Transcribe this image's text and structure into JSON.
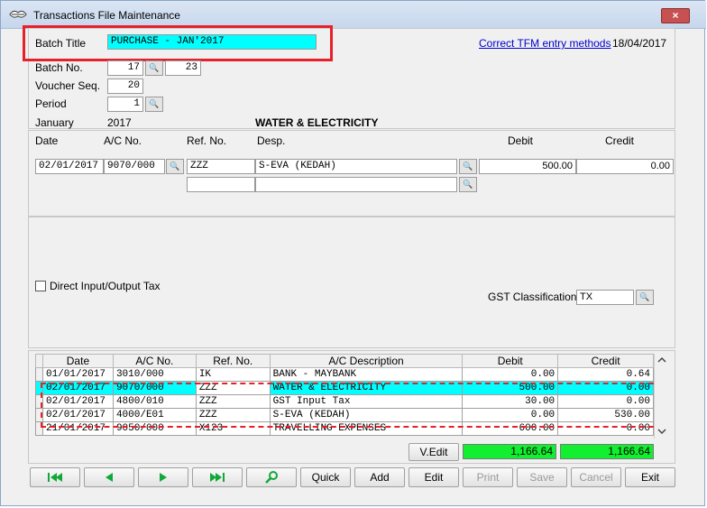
{
  "window": {
    "title": "Transactions File Maintenance",
    "close_glyph": "×"
  },
  "header": {
    "batch_title_label": "Batch Title",
    "batch_title_value": "PURCHASE - JAN'2017",
    "link_text": "Correct TFM entry methods",
    "date": "18/04/2017",
    "batch_no_label": "Batch No.",
    "batch_no_value": "17",
    "batch_no_extra": "23",
    "voucher_seq_label": "Voucher Seq.",
    "voucher_seq_value": "20",
    "period_label": "Period",
    "period_value": "1",
    "month": "January",
    "year": "2017",
    "account_name": "WATER & ELECTRICITY"
  },
  "entry": {
    "col_date": "Date",
    "col_ac": "A/C No.",
    "col_ref": "Ref. No.",
    "col_desp": "Desp.",
    "col_debit": "Debit",
    "col_credit": "Credit",
    "row_date": "02/01/2017",
    "row_ac": "9070/000",
    "row_ref": "ZZZ",
    "row_desp": "S-EVA (KEDAH)",
    "row_debit": "500.00",
    "row_credit": "0.00",
    "direct_tax_label": "Direct Input/Output Tax",
    "gst_label": "GST Classification",
    "gst_value": "TX"
  },
  "grid": {
    "headers": [
      "Date",
      "A/C No.",
      "Ref. No.",
      "A/C Description",
      "Debit",
      "Credit"
    ],
    "rows": [
      {
        "date": "01/01/2017",
        "ac": "3010/000",
        "ref": "IK",
        "desc": "BANK - MAYBANK",
        "debit": "0.00",
        "credit": "0.64"
      },
      {
        "date": "02/01/2017",
        "ac": "9070/000",
        "ref": "ZZZ",
        "desc": "WATER & ELECTRICITY",
        "debit": "500.00",
        "credit": "0.00"
      },
      {
        "date": "02/01/2017",
        "ac": "4800/010",
        "ref": "ZZZ",
        "desc": "GST Input Tax",
        "debit": "30.00",
        "credit": "0.00"
      },
      {
        "date": "02/01/2017",
        "ac": "4000/E01",
        "ref": "ZZZ",
        "desc": "S-EVA (KEDAH)",
        "debit": "0.00",
        "credit": "530.00"
      },
      {
        "date": "21/01/2017",
        "ac": "9050/000",
        "ref": "X123",
        "desc": "TRAVELLING EXPENSES",
        "debit": "600.00",
        "credit": "0.00"
      }
    ],
    "vedit_label": "V.Edit",
    "total_debit": "1,166.64",
    "total_credit": "1,166.64"
  },
  "toolbar": {
    "quick": "Quick",
    "add": "Add",
    "edit": "Edit",
    "print": "Print",
    "save": "Save",
    "cancel": "Cancel",
    "exit": "Exit"
  },
  "colors": {
    "accent_green": "#11a83a",
    "highlight_red": "#e8202a",
    "selected_cyan": "#00ffff"
  }
}
